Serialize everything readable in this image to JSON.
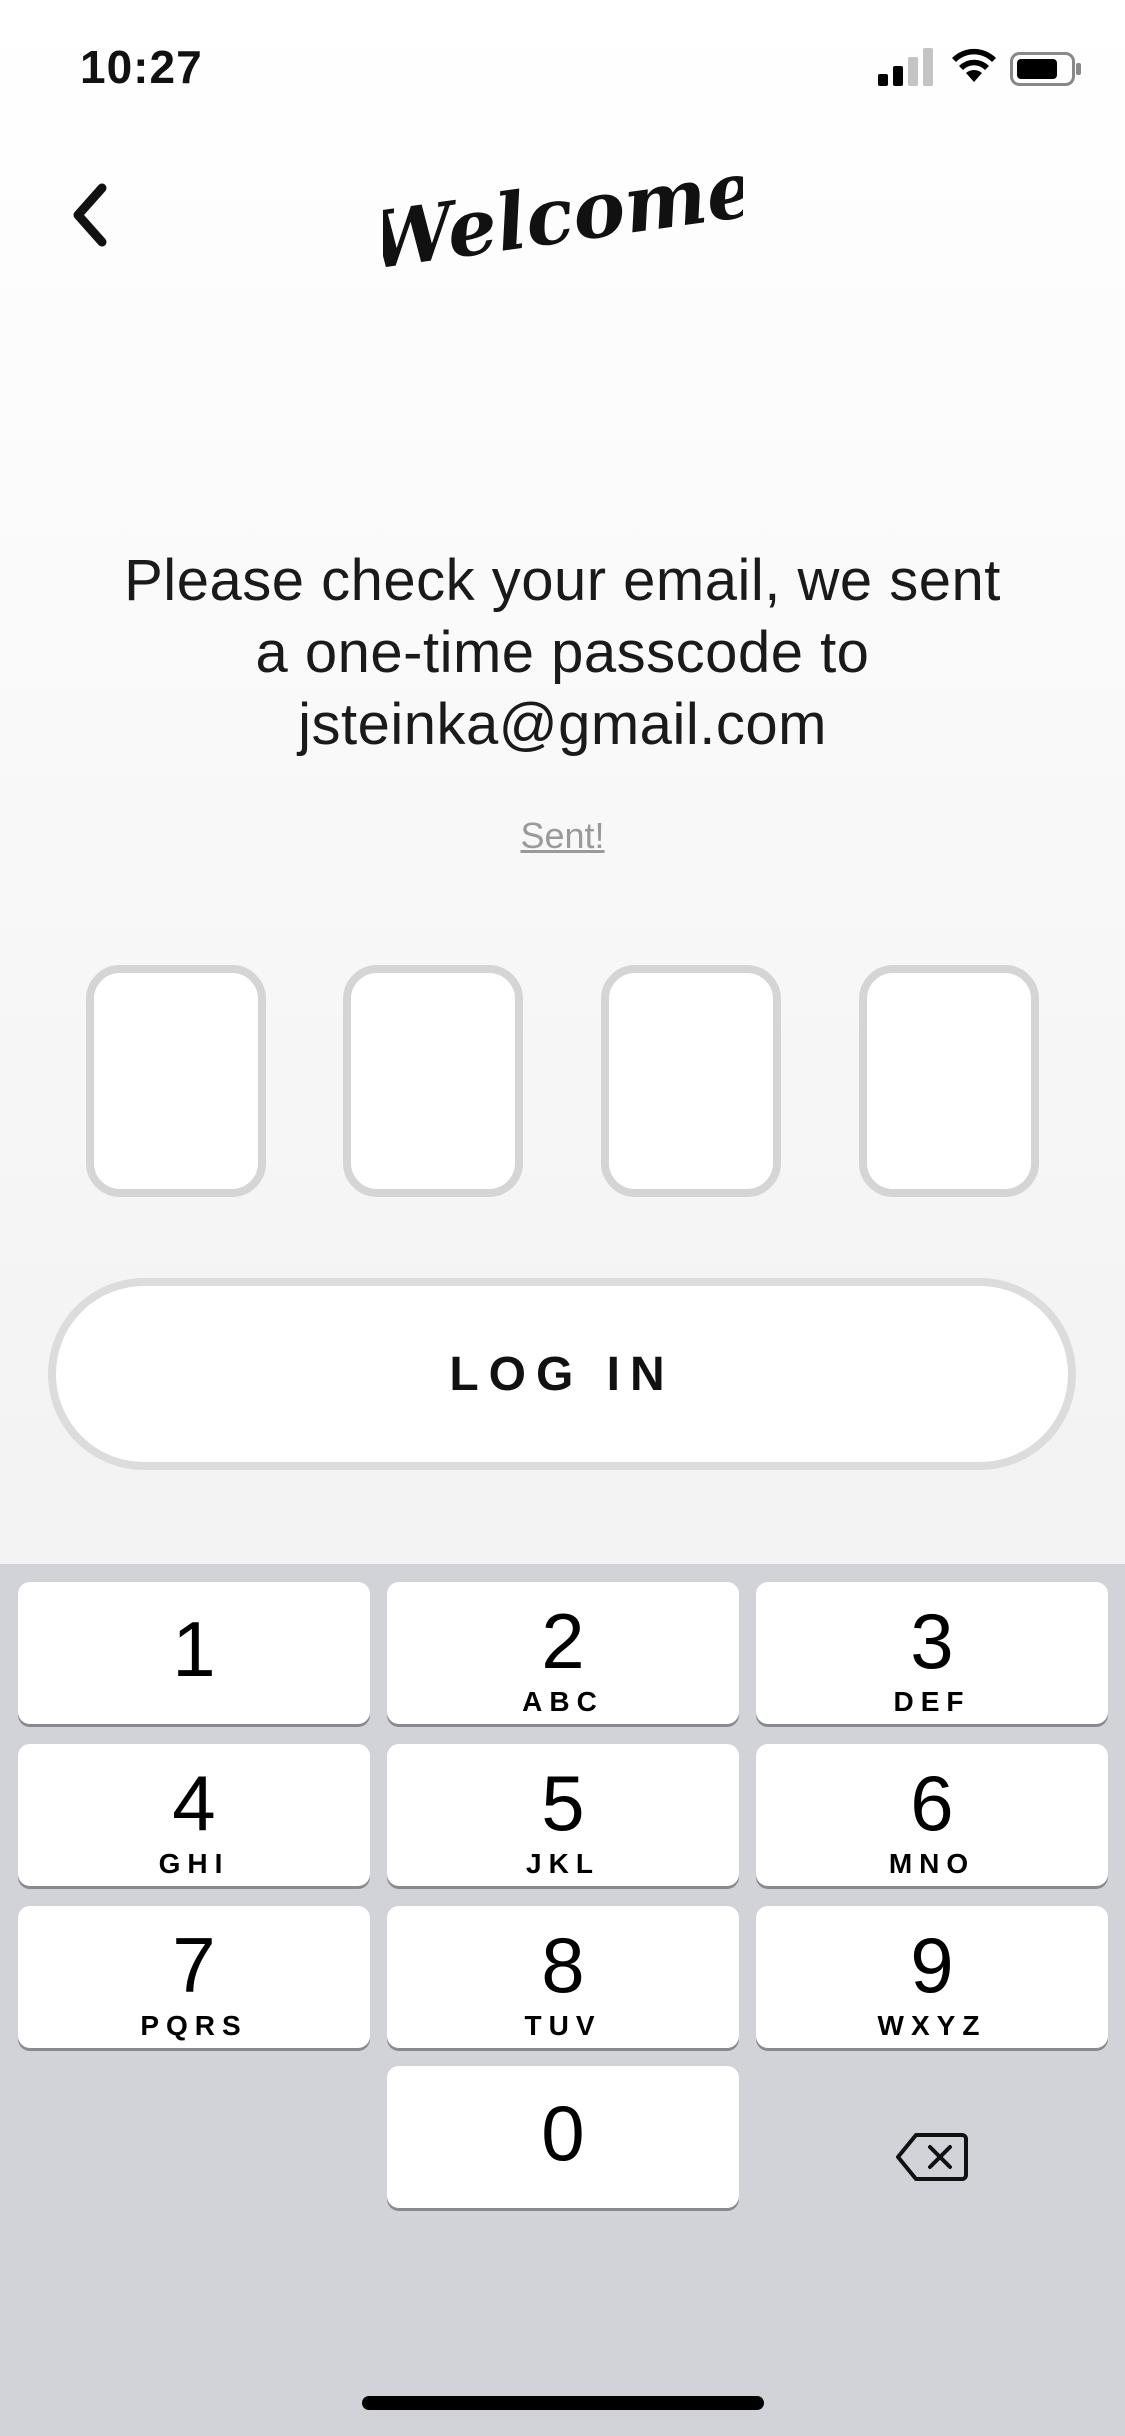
{
  "status": {
    "time": "10:27"
  },
  "header": {
    "logo_text": "Welcome"
  },
  "message": {
    "line1": "Please check your email, we sent",
    "line2": "a one-time passcode to",
    "line3": "jsteinka@gmail.com"
  },
  "sent_label": "Sent!",
  "code_boxes": [
    "",
    "",
    "",
    ""
  ],
  "login_label": "LOG IN",
  "keypad": {
    "keys": [
      {
        "digit": "1",
        "letters": ""
      },
      {
        "digit": "2",
        "letters": "ABC"
      },
      {
        "digit": "3",
        "letters": "DEF"
      },
      {
        "digit": "4",
        "letters": "GHI"
      },
      {
        "digit": "5",
        "letters": "JKL"
      },
      {
        "digit": "6",
        "letters": "MNO"
      },
      {
        "digit": "7",
        "letters": "PQRS"
      },
      {
        "digit": "8",
        "letters": "TUV"
      },
      {
        "digit": "9",
        "letters": "WXYZ"
      },
      {
        "digit": "0",
        "letters": ""
      }
    ]
  },
  "icons": {
    "back": "chevron-left-icon",
    "delete": "backspace-icon",
    "signal": "cellular-signal-icon",
    "wifi": "wifi-icon",
    "battery": "battery-icon"
  },
  "colors": {
    "keypad_bg": "#d1d3d9",
    "box_border": "#d5d5d5",
    "sent_link": "#9a9a9a"
  }
}
